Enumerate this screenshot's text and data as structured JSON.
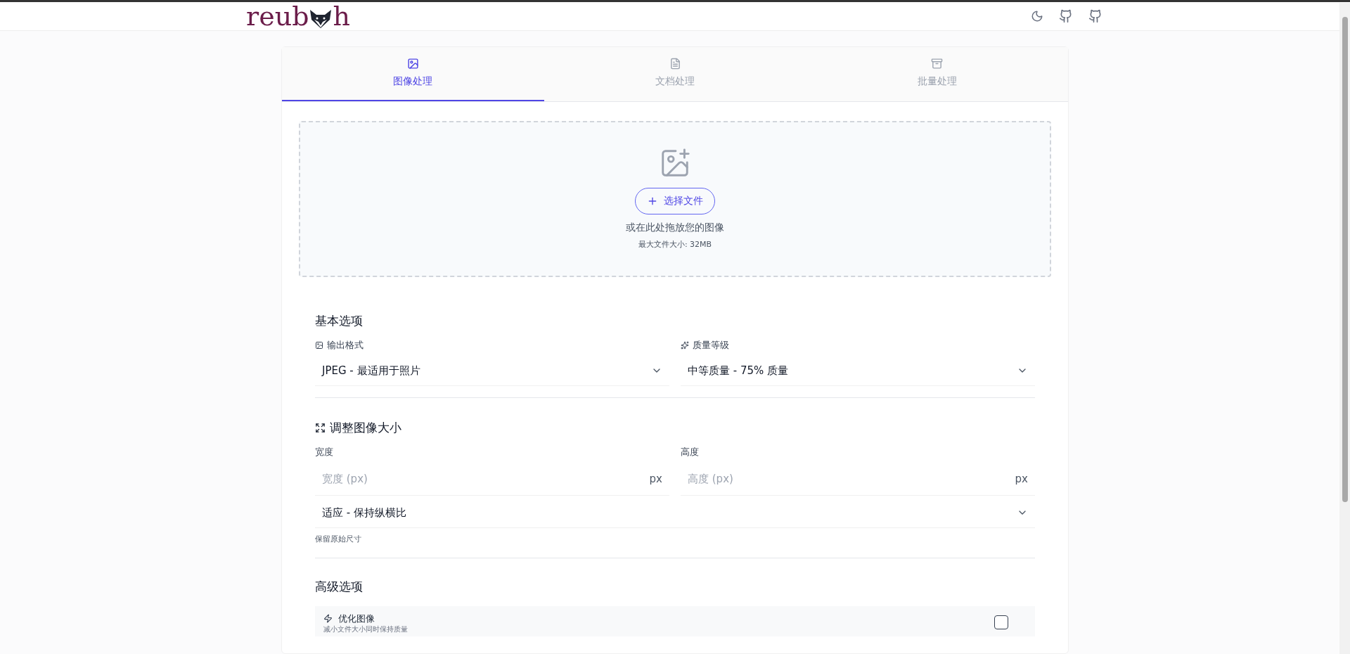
{
  "header": {
    "logo": {
      "before": "reub",
      "after": "h"
    }
  },
  "tabs": [
    {
      "label": "图像处理",
      "selected": true
    },
    {
      "label": "文档处理",
      "selected": false
    },
    {
      "label": "批量处理",
      "selected": false
    }
  ],
  "upload": {
    "button": "选择文件",
    "hint": "或在此处拖放您的图像",
    "limit": "最大文件大小: 32MB"
  },
  "basic": {
    "title": "基本选项",
    "fields": [
      {
        "label": "输出格式",
        "value": "JPEG - 最适用于照片"
      },
      {
        "label": "质量等级",
        "value": "中等质量 - 75% 质量"
      }
    ]
  },
  "resize": {
    "title": "调整图像大小",
    "inputs": [
      {
        "label": "宽度",
        "placeholder": "宽度 (px)",
        "unit": "px"
      },
      {
        "label": "高度",
        "placeholder": "高度 (px)",
        "unit": "px"
      }
    ],
    "fit": "适应 - 保持纵横比",
    "note": "保留原始尺寸"
  },
  "advanced": {
    "title": "高级选项",
    "options": [
      {
        "label": "优化图像",
        "description": "减小文件大小同时保持质量",
        "checked": false
      }
    ]
  }
}
